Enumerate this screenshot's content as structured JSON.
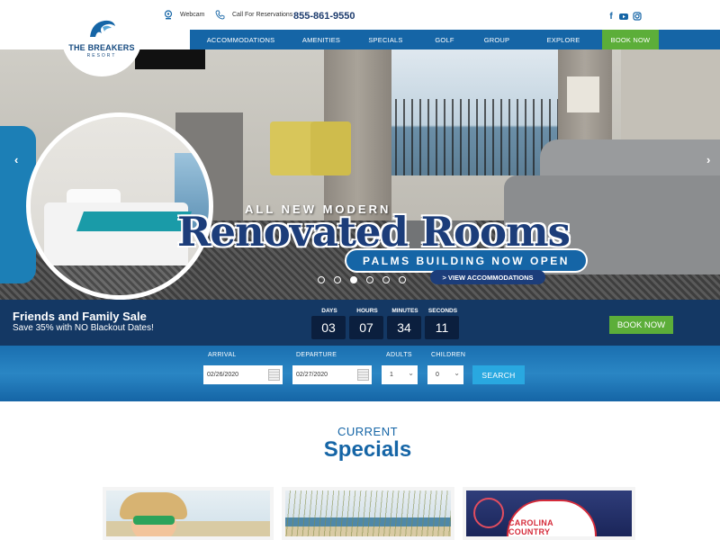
{
  "header": {
    "webcam_label": "Webcam",
    "reservations_label": "Call For Reservations",
    "phone": "855-861-9550",
    "social": [
      "facebook-icon",
      "youtube-icon",
      "instagram-icon"
    ],
    "logo_title": "THE BREAKERS",
    "logo_subtitle": "RESORT"
  },
  "nav": {
    "items": [
      "ACCOMMODATIONS",
      "AMENITIES",
      "SPECIALS",
      "GOLF",
      "GROUP",
      "EXPLORE"
    ],
    "book_label": "BOOK NOW"
  },
  "hero": {
    "pre_title": "ALL NEW MODERN",
    "title": "Renovated Rooms",
    "banner": "PALMS BUILDING NOW OPEN",
    "cta": "> VIEW ACCOMMODATIONS",
    "slides": 6,
    "active_slide": 3,
    "prev_icon": "chevron-left-icon",
    "next_icon": "chevron-right-icon"
  },
  "sale": {
    "title": "Friends and Family Sale",
    "subtitle": "Save 35% with NO Blackout Dates!",
    "countdown": [
      {
        "label": "DAYS",
        "value": "03"
      },
      {
        "label": "HOURS",
        "value": "07"
      },
      {
        "label": "MINUTES",
        "value": "34"
      },
      {
        "label": "SECONDS",
        "value": "11"
      }
    ],
    "book_label": "BOOK NOW"
  },
  "booking": {
    "arrival_label": "ARRIVAL",
    "arrival_value": "02/26/2020",
    "departure_label": "DEPARTURE",
    "departure_value": "02/27/2020",
    "adults_label": "ADULTS",
    "adults_value": "1",
    "children_label": "CHILDREN",
    "children_value": "0",
    "search_label": "SEARCH"
  },
  "specials": {
    "eyebrow": "CURRENT",
    "title": "Specials",
    "card3_logo_text": "CAROLINA COUNTRY"
  },
  "colors": {
    "brand_blue": "#1565a6",
    "navy": "#143864",
    "green": "#5cae39",
    "search_blue": "#29a8e0"
  }
}
